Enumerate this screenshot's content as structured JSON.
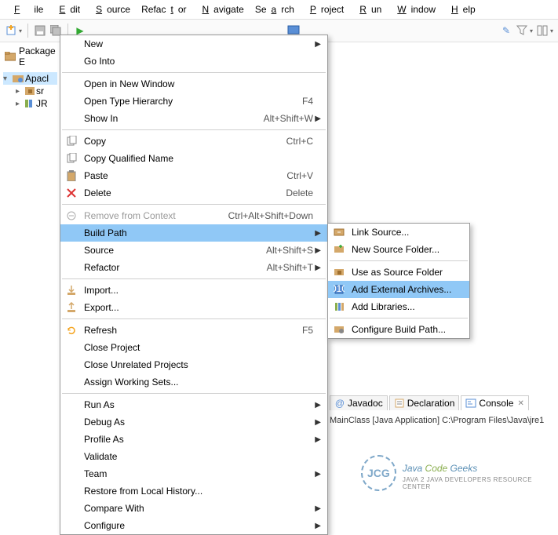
{
  "menubar": [
    "File",
    "Edit",
    "Source",
    "Refactor",
    "Navigate",
    "Search",
    "Project",
    "Run",
    "Window",
    "Help"
  ],
  "sidebar": {
    "title": "Package E",
    "project": "Apacl",
    "children": [
      "sr",
      "JR"
    ]
  },
  "context_menu": [
    {
      "label": "New",
      "arrow": true
    },
    {
      "label": "Go Into"
    },
    {
      "sep": true
    },
    {
      "label": "Open in New Window"
    },
    {
      "label": "Open Type Hierarchy",
      "shortcut": "F4"
    },
    {
      "label": "Show In",
      "shortcut": "Alt+Shift+W",
      "arrow": true
    },
    {
      "sep": true
    },
    {
      "icon": "copy",
      "label": "Copy",
      "shortcut": "Ctrl+C"
    },
    {
      "icon": "copy",
      "label": "Copy Qualified Name"
    },
    {
      "icon": "paste",
      "label": "Paste",
      "shortcut": "Ctrl+V"
    },
    {
      "icon": "delete",
      "label": "Delete",
      "shortcut": "Delete"
    },
    {
      "sep": true
    },
    {
      "icon": "remove",
      "label": "Remove from Context",
      "shortcut": "Ctrl+Alt+Shift+Down",
      "disabled": true
    },
    {
      "label": "Build Path",
      "arrow": true,
      "highlighted": true
    },
    {
      "label": "Source",
      "shortcut": "Alt+Shift+S",
      "arrow": true
    },
    {
      "label": "Refactor",
      "shortcut": "Alt+Shift+T",
      "arrow": true
    },
    {
      "sep": true
    },
    {
      "icon": "import",
      "label": "Import..."
    },
    {
      "icon": "export",
      "label": "Export..."
    },
    {
      "sep": true
    },
    {
      "icon": "refresh",
      "label": "Refresh",
      "shortcut": "F5"
    },
    {
      "label": "Close Project"
    },
    {
      "label": "Close Unrelated Projects"
    },
    {
      "label": "Assign Working Sets..."
    },
    {
      "sep": true
    },
    {
      "label": "Run As",
      "arrow": true
    },
    {
      "label": "Debug As",
      "arrow": true
    },
    {
      "label": "Profile As",
      "arrow": true
    },
    {
      "label": "Validate"
    },
    {
      "label": "Team",
      "arrow": true
    },
    {
      "label": "Restore from Local History..."
    },
    {
      "label": "Compare With",
      "arrow": true
    },
    {
      "label": "Configure",
      "arrow": true
    }
  ],
  "submenu": [
    {
      "icon": "link",
      "label": "Link Source..."
    },
    {
      "icon": "newfolder",
      "label": "New Source Folder..."
    },
    {
      "sep": true
    },
    {
      "icon": "srcfolder",
      "label": "Use as Source Folder"
    },
    {
      "icon": "archive",
      "label": "Add External Archives...",
      "highlighted": true
    },
    {
      "icon": "library",
      "label": "Add Libraries..."
    },
    {
      "sep": true
    },
    {
      "icon": "config",
      "label": "Configure Build Path..."
    }
  ],
  "bottom_tabs": [
    {
      "icon": "at",
      "label": "Javadoc"
    },
    {
      "icon": "decl",
      "label": "Declaration"
    },
    {
      "icon": "console",
      "label": "Console",
      "active": true,
      "closable": true
    }
  ],
  "status": "MainClass [Java Application] C:\\Program Files\\Java\\jre1",
  "logo": {
    "brand_pre": "Java ",
    "brand_mid": "Code",
    "brand_post": " Geeks",
    "tagline": "Java 2 Java Developers Resource Center",
    "badge": "JCG"
  }
}
